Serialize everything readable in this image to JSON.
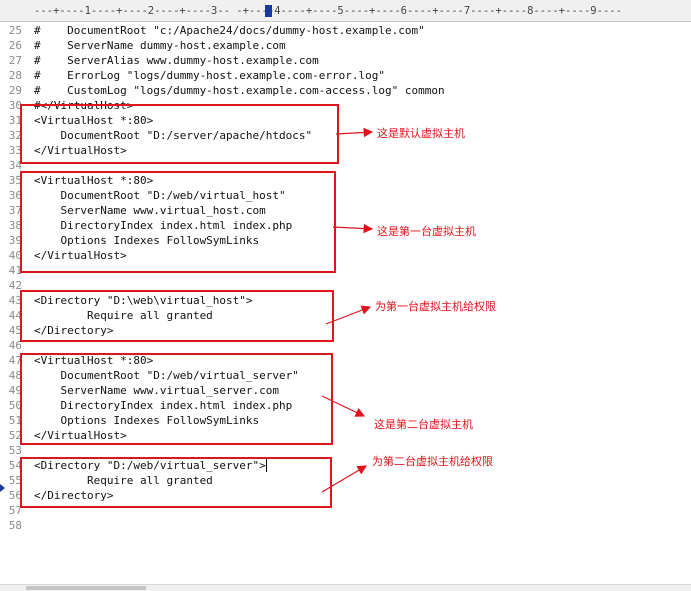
{
  "ruler": {
    "text": "---+----1----+----2----+----3-- -+----4----+----5----+----6----+----7----+----8----+----9----"
  },
  "lines": [
    {
      "num": "25",
      "text": "#    DocumentRoot \"c:/Apache24/docs/dummy-host.example.com\""
    },
    {
      "num": "26",
      "text": "#    ServerName dummy-host.example.com"
    },
    {
      "num": "27",
      "text": "#    ServerAlias www.dummy-host.example.com"
    },
    {
      "num": "28",
      "text": "#    ErrorLog \"logs/dummy-host.example.com-error.log\""
    },
    {
      "num": "29",
      "text": "#    CustomLog \"logs/dummy-host.example.com-access.log\" common"
    },
    {
      "num": "30",
      "text": "#</VirtualHost>"
    },
    {
      "num": "31",
      "text": "<VirtualHost *:80>"
    },
    {
      "num": "32",
      "text": "    DocumentRoot \"D:/server/apache/htdocs\""
    },
    {
      "num": "33",
      "text": "</VirtualHost>"
    },
    {
      "num": "34",
      "text": ""
    },
    {
      "num": "35",
      "text": "<VirtualHost *:80>"
    },
    {
      "num": "36",
      "text": "    DocumentRoot \"D:/web/virtual_host\""
    },
    {
      "num": "37",
      "text": "    ServerName www.virtual_host.com"
    },
    {
      "num": "38",
      "text": "    DirectoryIndex index.html index.php"
    },
    {
      "num": "39",
      "text": "    Options Indexes FollowSymLinks"
    },
    {
      "num": "40",
      "text": "</VirtualHost>"
    },
    {
      "num": "41",
      "text": ""
    },
    {
      "num": "42",
      "text": ""
    },
    {
      "num": "43",
      "text": "<Directory \"D:\\web\\virtual_host\">"
    },
    {
      "num": "44",
      "text": "        Require all granted"
    },
    {
      "num": "45",
      "text": "</Directory>"
    },
    {
      "num": "46",
      "text": ""
    },
    {
      "num": "47",
      "text": "<VirtualHost *:80>"
    },
    {
      "num": "48",
      "text": "    DocumentRoot \"D:/web/virtual_server\""
    },
    {
      "num": "49",
      "text": "    ServerName www.virtual_server.com"
    },
    {
      "num": "50",
      "text": "    DirectoryIndex index.html index.php"
    },
    {
      "num": "51",
      "text": "    Options Indexes FollowSymLinks"
    },
    {
      "num": "52",
      "text": "</VirtualHost>"
    },
    {
      "num": "53",
      "text": ""
    },
    {
      "num": "54",
      "text": "<Directory \"D:/web/virtual_server\">"
    },
    {
      "num": "55",
      "text": "        Require all granted"
    },
    {
      "num": "56",
      "text": "</Directory>"
    },
    {
      "num": "57",
      "text": ""
    },
    {
      "num": "58",
      "text": ""
    }
  ],
  "annotations": [
    "这是默认虚拟主机",
    "这是第一台虚拟主机",
    "为第一台虚拟主机给权限",
    "这是第二台虚拟主机",
    "为第二台虚拟主机给权限"
  ],
  "colors": {
    "annotation": "#e0141e",
    "line_number": "#8a8a8a",
    "marker": "#1a3a9a"
  }
}
